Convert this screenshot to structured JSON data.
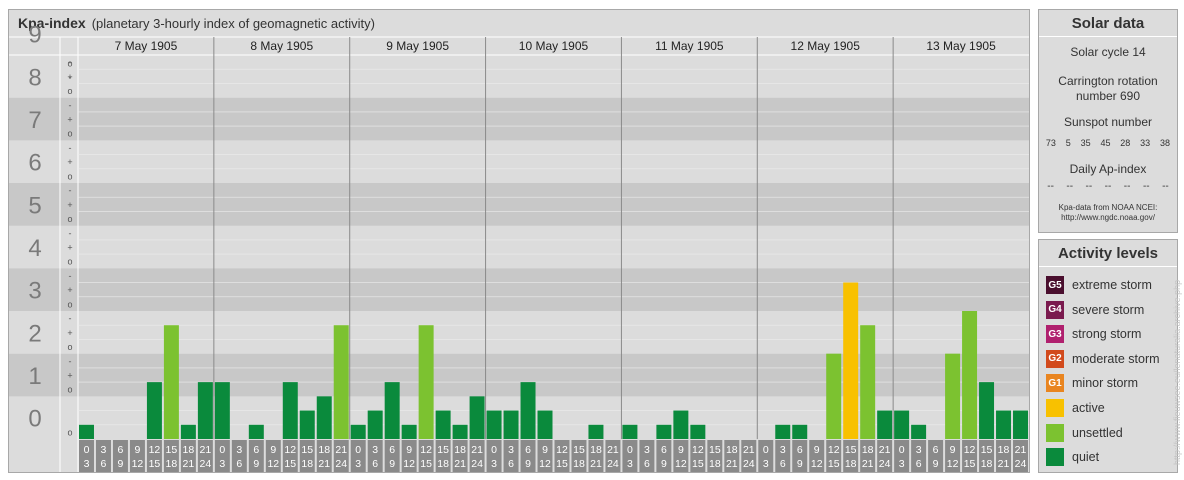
{
  "chart_title": "Kpa-index",
  "chart_subtitle": "(planetary 3-hourly index of geomagnetic activity)",
  "chart_data": {
    "type": "bar",
    "title": "Kpa-index",
    "subtitle": "(planetary 3-hourly index of geomagnetic activity)",
    "ylim": [
      0,
      9
    ],
    "y_ticks": [
      "0",
      "1",
      "2",
      "3",
      "4",
      "5",
      "6",
      "7",
      "8",
      "9"
    ],
    "y_minor_ticks": [
      "o",
      "+",
      "-"
    ],
    "days": [
      "7 May 1905",
      "8 May 1905",
      "9 May 1905",
      "10 May 1905",
      "11 May 1905",
      "12 May 1905",
      "13 May 1905"
    ],
    "interval_starts": [
      "0",
      "3",
      "6",
      "9",
      "12",
      "15",
      "18",
      "21"
    ],
    "interval_ends": [
      "3",
      "6",
      "9",
      "12",
      "15",
      "18",
      "21",
      "24"
    ],
    "values": [
      [
        0.333,
        0.0,
        0.0,
        0.0,
        1.333,
        2.667,
        0.333,
        1.333
      ],
      [
        1.333,
        0.0,
        0.333,
        0.0,
        1.333,
        0.667,
        1.0,
        2.667
      ],
      [
        0.333,
        0.667,
        1.333,
        0.333,
        2.667,
        0.667,
        0.333,
        1.0
      ],
      [
        0.667,
        0.667,
        1.333,
        0.667,
        0.0,
        0.0,
        0.333,
        0.0
      ],
      [
        0.333,
        0.0,
        0.333,
        0.667,
        0.333,
        0.0,
        0.0,
        0.0
      ],
      [
        0.0,
        0.333,
        0.333,
        0.0,
        2.0,
        3.667,
        2.667,
        0.667
      ],
      [
        0.667,
        0.333,
        0.0,
        2.0,
        3.0,
        1.333,
        0.667,
        0.667
      ]
    ],
    "grid": true
  },
  "solar": {
    "title": "Solar data",
    "cycle": "Solar cycle 14",
    "carrington_line1": "Carrington rotation",
    "carrington_line2": "number 690",
    "sunspot_title": "Sunspot number",
    "sunspot_values": [
      "73",
      "5",
      "35",
      "45",
      "28",
      "33",
      "38"
    ],
    "ap_title": "Daily Ap-index",
    "ap_values": [
      "--",
      "--",
      "--",
      "--",
      "--",
      "--",
      "--"
    ],
    "credit_line1": "Kpa-data from NOAA NCEI:",
    "credit_line2": "http://www.ngdc.noaa.gov/"
  },
  "activity": {
    "title": "Activity levels",
    "levels": [
      {
        "code": "G5",
        "label": "extreme storm",
        "color": "#4a0f2e"
      },
      {
        "code": "G4",
        "label": "severe storm",
        "color": "#7a1a4e"
      },
      {
        "code": "G3",
        "label": "strong storm",
        "color": "#b0206e"
      },
      {
        "code": "G2",
        "label": "moderate storm",
        "color": "#d24a1c"
      },
      {
        "code": "G1",
        "label": "minor storm",
        "color": "#e98520"
      },
      {
        "code": "",
        "label": "active",
        "color": "#f8c100"
      },
      {
        "code": "",
        "label": "unsettled",
        "color": "#7cc230"
      },
      {
        "code": "",
        "label": "quiet",
        "color": "#0a8a3c"
      }
    ]
  },
  "colors": {
    "quiet": "#0a8a3c",
    "unsettled": "#7cc230",
    "active": "#f8c100",
    "panel": "#dcdcdc",
    "band_dark": "#c8c8c8",
    "axis_label": "#7a7a7a"
  },
  "watermark": "http://www.fieuwsee.eu/lenaturalia.archive.php"
}
